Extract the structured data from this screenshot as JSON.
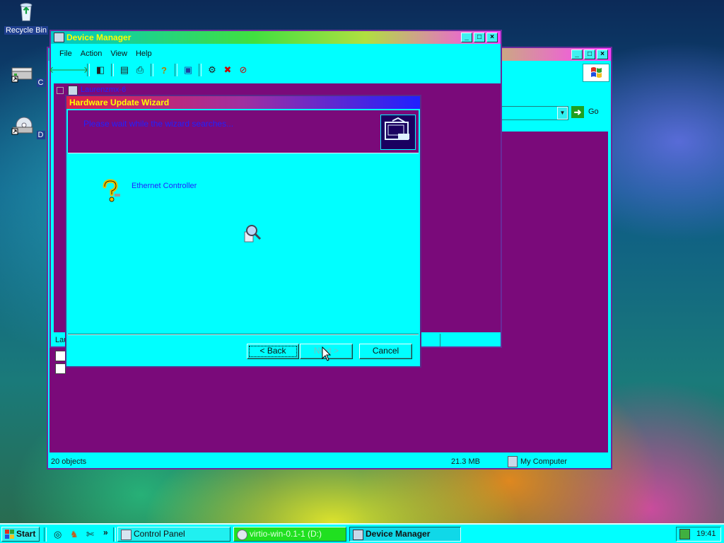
{
  "desktop": {
    "recycle_bin_label": "Recycle Bin",
    "drive_c_label": "C",
    "drive_d_label": "D"
  },
  "explorer": {
    "go_label": "Go",
    "status_objects": "20 objects",
    "status_size": "21.3 MB",
    "status_location": "My Computer"
  },
  "device_manager": {
    "title": "Device Manager",
    "menu": [
      "File",
      "Action",
      "View",
      "Help"
    ],
    "tree_root": "Laurenzmx-6",
    "status_left": "Lau"
  },
  "wizard": {
    "title": "Hardware Update Wizard",
    "header_text": "Please wait while the wizard searches...",
    "device_name": "Ethernet Controller",
    "back_label": "< Back",
    "next_label": "Next >",
    "cancel_label": "Cancel"
  },
  "taskbar": {
    "start_label": "Start",
    "tasks": [
      "Control Panel",
      "virtio-win-0.1-1 (D:)",
      "Device Manager"
    ],
    "clock": "19:41"
  },
  "colors": {
    "window_bg": "#00ffff",
    "content_bg": "#7a0a7a",
    "title_text": "#ffff00",
    "link_text": "#2222ff"
  }
}
